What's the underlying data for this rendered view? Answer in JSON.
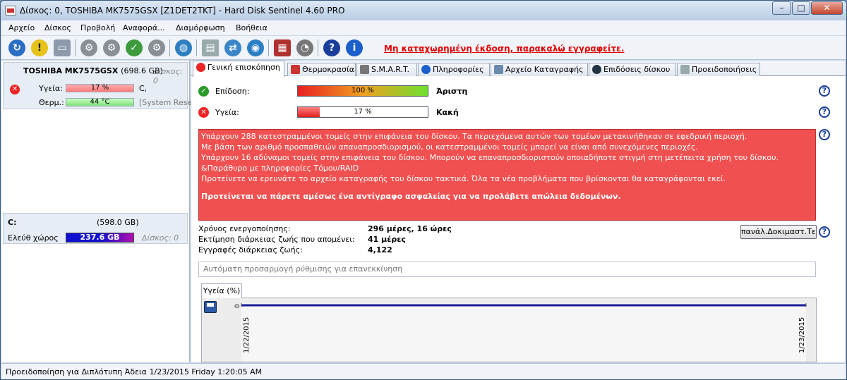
{
  "window": {
    "title": "Δίσκος: 0, TOSHIBA MK7575GSX [Z1DET2TKT]  -  Hard Disk Sentinel 4.60 PRO"
  },
  "menu": [
    "Αρχείο",
    "Δίσκος",
    "Προβολή",
    "Αναφορά...",
    "Διαμόρφωση",
    "Βοήθεια"
  ],
  "toolbar": {
    "register_link": "Μη καταχωρημένη έκδοση, παρακαλώ εγγραφείτε."
  },
  "left": {
    "disk": {
      "model": "TOSHIBA MK7575GSX",
      "size": "(698.6 GB)",
      "disk_label": "Δίσκος: 0",
      "health_label": "Υγεία:",
      "health_value": "17 %",
      "health_fraction": 0.17,
      "health_drive": "C,",
      "temp_label": "Θερμ.:",
      "temp_value": "44 °C",
      "temp_drive": "[System Rese"
    },
    "volume": {
      "letter": "C:",
      "size": "(598.0 GB)",
      "free_label": "Ελεύθ χώρος",
      "free_value": "237.6 GB",
      "disk_label": "Δίσκος: 0"
    }
  },
  "tabs": [
    "Γενική επισκόπηση",
    "Θερμοκρασία",
    "S.M.A.R.T.",
    "Πληροφορίες",
    "Αρχείο Καταγραφής",
    "Επιδόσεις δίσκου",
    "Προειδοποιήσεις"
  ],
  "overview": {
    "perf_label": "Επίδοση:",
    "perf_value": "100 %",
    "perf_fraction": 1.0,
    "perf_rating": "Άριστη",
    "health_label": "Υγεία:",
    "health_value": "17 %",
    "health_fraction": 0.17,
    "health_rating": "Κακή",
    "messages": [
      "Υπάρχουν 288 κατεστραμμένοι τομείς στην επιφάνεια του δίσκου. Τα περιεχόμενα αυτών των τομέων μετακινήθηκαν σε εφεδρική περιοχή.",
      "Με βάση των αριθμό προσπαθειών απαναπροσδιορισμού, οι κατεστραμμένοι τομείς μπορεί να είναι από συνεχόμενες περιοχές.",
      "Υπάρχουν 16 αδύναμοι τομείς στην επιφάνεια του δίσκου. Μπορούν να επαναπροσδιοριστούν οποιαδήποτε στιγμή στη μετέπειτα χρήση του δίσκου.",
      "&Παράθυρο με πληροφορίες Τόμου/RAID",
      "Προτείνετε να ερευνάτε το αρχείο καταγραφής του δίσκου τακτικά. Όλα τα νέα προβλήματα που βρίσκονται θα καταγράφονται εκεί."
    ],
    "message_bold": "Προτείνεται να πάρετε αμέσως ένα αντίγραφο ασφαλείας για να προλάβετε απώλεια δεδομένων.",
    "power_on_label": "Χρόνος ενεργοποίησης:",
    "power_on_value": "296 μέρες, 16 ώρες",
    "remaining_label": "Εκτίμηση διάρκειας ζωής που απομένει:",
    "remaining_value": "41 μέρες",
    "records_label": "Εγγραφές διάρκειας ζωής:",
    "records_value": "4,122",
    "selftest_button": "πανάλ.Δοκιμαστ.Τεσ",
    "auto_placeholder": "Αυτόματη προσαρμογή ρύθμισης για επανεκκίνηση",
    "chart_tab": "Υγεία (%)",
    "chart_y_tick": "0",
    "chart_x_start": "1/22/2015",
    "chart_x_end": "1/23/2015"
  },
  "status": {
    "text": "Προειδοποίηση για Διπλότυπη  Άδεια 1/23/2015 Friday 1:20:05 AM"
  }
}
